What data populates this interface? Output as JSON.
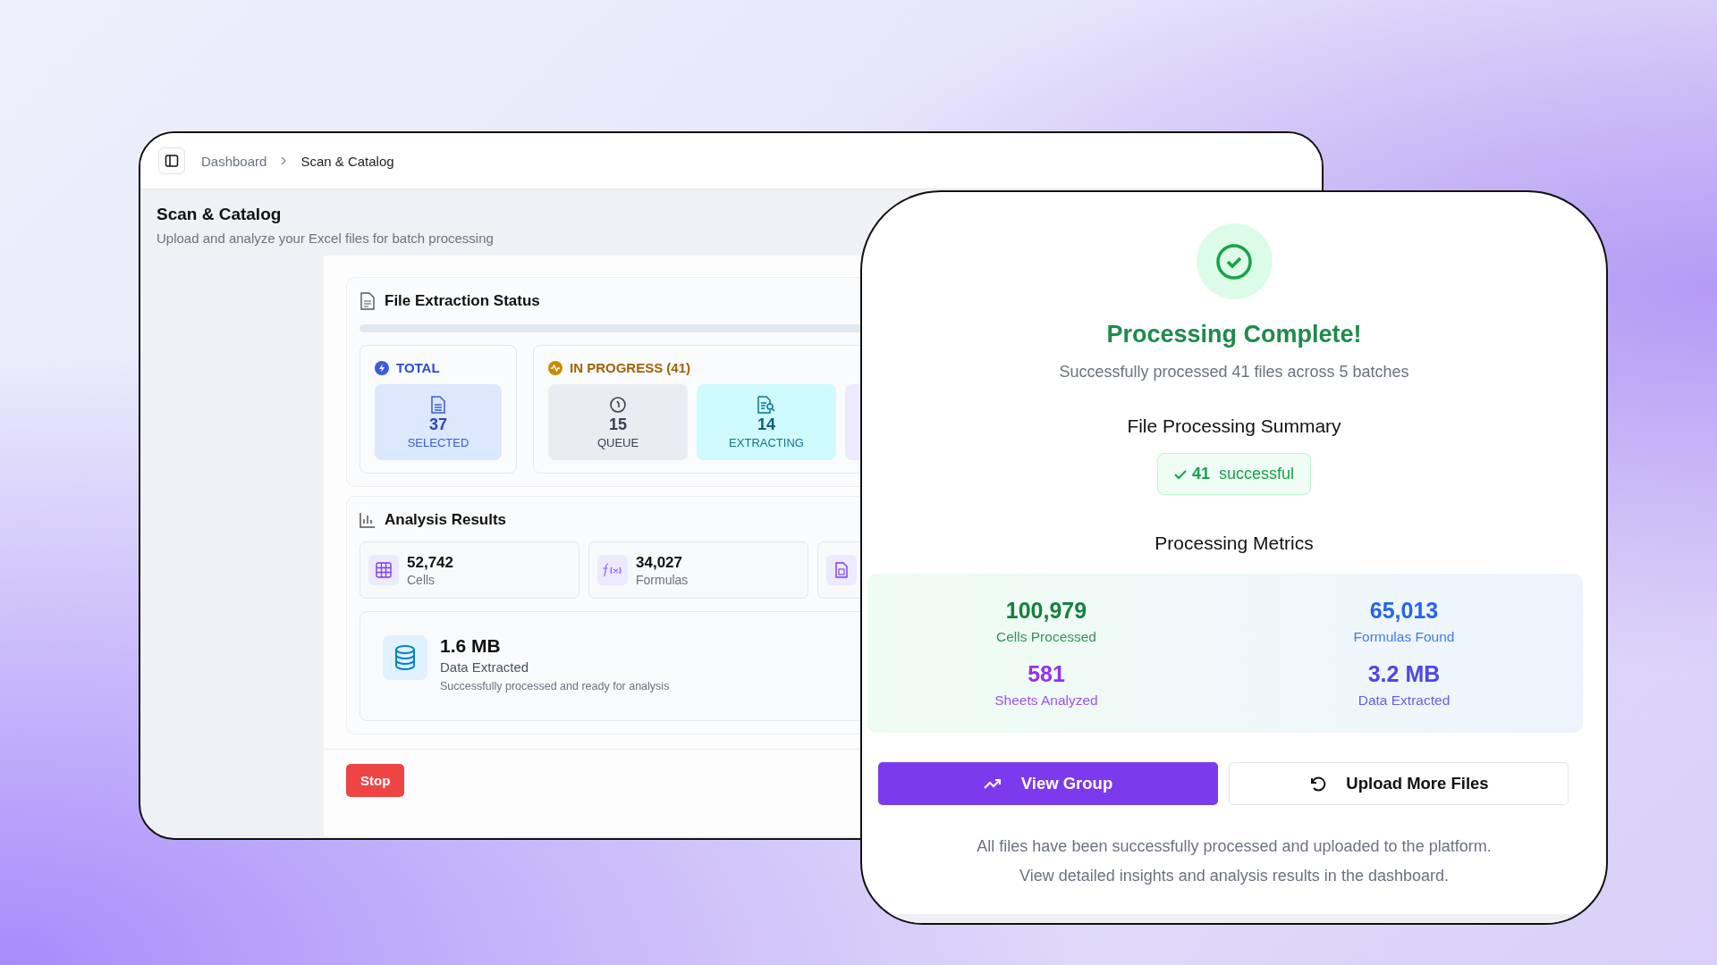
{
  "breadcrumb": [
    {
      "label": "Dashboard",
      "selected": false
    },
    {
      "label": "Scan & Catalog",
      "selected": true
    }
  ],
  "page": {
    "title": "Scan & Catalog",
    "subtitle": "Upload and analyze your Excel files for batch processing"
  },
  "extraction": {
    "title": "File Extraction Status",
    "groups": [
      {
        "label": "TOTAL",
        "kind": "total",
        "tiles": [
          {
            "kind": "selected",
            "value": "37",
            "label": "SELECTED"
          }
        ]
      },
      {
        "label": "IN PROGRESS (41)",
        "kind": "progress",
        "tiles": [
          {
            "kind": "queue",
            "value": "15",
            "label": "QUEUE"
          },
          {
            "kind": "extracting",
            "value": "14",
            "label": "EXTRACTING"
          },
          {
            "kind": "other"
          }
        ]
      }
    ]
  },
  "analysis": {
    "title": "Analysis Results",
    "stats": [
      {
        "kind": "cells",
        "value": "52,742",
        "label": "Cells"
      },
      {
        "kind": "formulas",
        "value": "34,027",
        "label": "Formulas"
      },
      {
        "kind": "document"
      }
    ],
    "data": {
      "value": "1.6 MB",
      "label": "Data Extracted",
      "note": "Successfully processed and ready for analysis"
    }
  },
  "stop_button": "Stop",
  "dialog": {
    "title": "Processing Complete!",
    "subtitle": "Successfully processed 41 files across 5 batches",
    "summary_title": "File Processing Summary",
    "badge": {
      "count": "41",
      "label": "successful"
    },
    "metrics_title": "Processing Metrics",
    "metrics": [
      {
        "value": "100,979",
        "label": "Cells Processed",
        "color": "#15803d"
      },
      {
        "value": "65,013",
        "label": "Formulas Found",
        "color": "#2563eb"
      },
      {
        "value": "581",
        "label": "Sheets Analyzed",
        "color": "#9333ea"
      },
      {
        "value": "3.2 MB",
        "label": "Data Extracted",
        "color": "#4f46e5"
      }
    ],
    "buttons": [
      {
        "kind": "primary",
        "label": "View Group"
      },
      {
        "kind": "secondary",
        "label": "Upload More Files"
      }
    ],
    "footer": [
      "All files have been successfully processed and uploaded to the platform.",
      "View detailed insights and analysis results in the dashboard."
    ]
  }
}
